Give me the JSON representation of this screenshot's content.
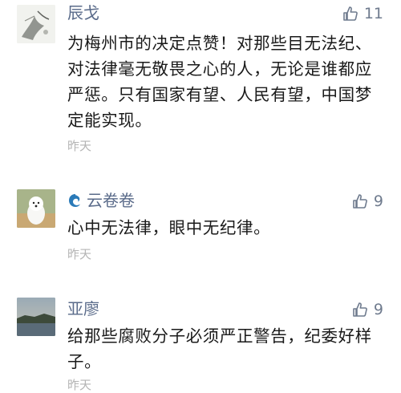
{
  "comments": [
    {
      "username": "辰戈",
      "likes": "11",
      "text": "为梅州市的决定点赞！对那些目无法纪、对法律毫无敬畏之心的人，无论是谁都应严惩。只有国家有望、人民有望，中国梦定能实现。",
      "time": "昨天",
      "avatar_icon": "ink-painting-avatar"
    },
    {
      "username": "云卷卷",
      "likes": "9",
      "text": "心中无法律，眼中无纪律。",
      "time": "昨天",
      "avatar_icon": "dog-photo-avatar"
    },
    {
      "username": "亚廖",
      "likes": "9",
      "text": "给那些腐败分子必须严正警告，纪委好样子。",
      "time": "昨天",
      "avatar_icon": "landscape-photo-avatar"
    }
  ],
  "colors": {
    "username": "#5a6b8a",
    "text": "#1a1a1a",
    "time": "#b4b4b4",
    "like": "#6f7b8e"
  }
}
